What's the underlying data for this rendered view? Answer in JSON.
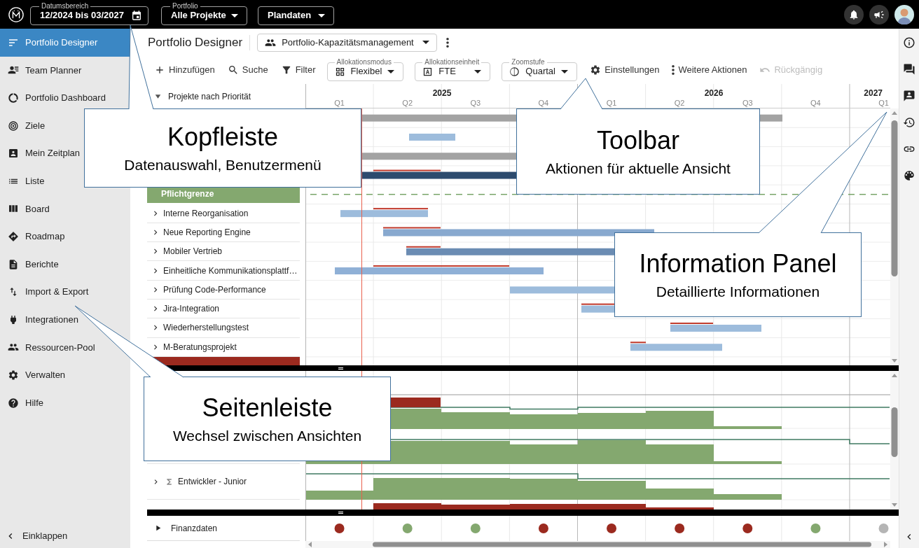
{
  "header": {
    "date_range": {
      "label": "Datumsbereich",
      "value": "12/2024 bis 03/2027"
    },
    "portfolio": {
      "label": "Portfolio",
      "value": "Alle Projekte"
    },
    "data_source": {
      "value": "Plandaten"
    }
  },
  "sidebar": {
    "items": [
      {
        "label": "Portfolio Designer",
        "selected": true
      },
      {
        "label": "Team Planner",
        "selected": false
      },
      {
        "label": "Portfolio Dashboard",
        "selected": false
      },
      {
        "label": "Ziele",
        "selected": false
      },
      {
        "label": "Mein Zeitplan",
        "selected": false
      },
      {
        "label": "Liste",
        "selected": false
      },
      {
        "label": "Board",
        "selected": false
      },
      {
        "label": "Roadmap",
        "selected": false
      },
      {
        "label": "Berichte",
        "selected": false
      },
      {
        "label": "Import & Export",
        "selected": false
      },
      {
        "label": "Integrationen",
        "selected": false
      },
      {
        "label": "Ressourcen-Pool",
        "selected": false
      },
      {
        "label": "Verwalten",
        "selected": false
      },
      {
        "label": "Hilfe",
        "selected": false
      }
    ],
    "collapse": "Einklappen"
  },
  "page": {
    "title": "Portfolio Designer",
    "view": "Portfolio-Kapazitätsmanagement"
  },
  "toolbar": [
    {
      "kind": "action",
      "label": "Hinzufügen",
      "disabled": false
    },
    {
      "kind": "action",
      "label": "Suche",
      "disabled": false
    },
    {
      "kind": "action",
      "label": "Filter",
      "disabled": false
    },
    {
      "kind": "select",
      "label": "Allokationsmodus",
      "value": "Flexibel"
    },
    {
      "kind": "select",
      "label": "Allokationseinheit",
      "value": "FTE"
    },
    {
      "kind": "select",
      "label": "Zoomstufe",
      "value": "Quartal"
    },
    {
      "kind": "action",
      "label": "Einstellungen",
      "disabled": false
    },
    {
      "kind": "action",
      "label": "Weitere Aktionen",
      "disabled": false
    },
    {
      "kind": "action",
      "label": "Rückgängig",
      "disabled": true
    }
  ],
  "timeline": {
    "years": [
      "2025",
      "2026",
      "2027"
    ],
    "quarters": [
      "Q1",
      "Q2",
      "Q3",
      "Q4",
      "Q1",
      "Q2",
      "Q3",
      "Q4",
      "Q1"
    ]
  },
  "projects": {
    "header": "Projekte nach Priorität",
    "expanded": true,
    "rows": [
      {
        "kind": "limit",
        "label": "Pflichtgrenze"
      },
      {
        "kind": "project",
        "label": "Interne Reorganisation",
        "expanded": false
      },
      {
        "kind": "project",
        "label": "Neue Reporting Engine",
        "expanded": false
      },
      {
        "kind": "project",
        "label": "Mobiler Vertrieb",
        "expanded": false
      },
      {
        "kind": "project",
        "label": "Einheitliche Kommunikationsplattf…",
        "expanded": false
      },
      {
        "kind": "project",
        "label": "Prüfung Code-Performance",
        "expanded": false
      },
      {
        "kind": "project",
        "label": "Jira-Integration",
        "expanded": false
      },
      {
        "kind": "project",
        "label": "Wiederherstellungstest",
        "expanded": false
      },
      {
        "kind": "project",
        "label": "M-Beratungsprojekt",
        "expanded": false
      }
    ]
  },
  "resources": {
    "rows": [
      {
        "label": "Entwickler - Junior",
        "expanded": false
      }
    ]
  },
  "finance": {
    "label": "Finanzdaten",
    "expanded": false,
    "dots": [
      {
        "color": "#9b2a1f"
      },
      {
        "color": "#84a86f"
      },
      {
        "color": "#84a86f"
      },
      {
        "color": "#9b2a1f"
      },
      {
        "color": "#9b2a1f"
      },
      {
        "color": "#9b2a1f"
      },
      {
        "color": "#9b2a1f"
      },
      {
        "color": "#84a86f"
      },
      {
        "color": "#b5b5b5"
      }
    ]
  },
  "callouts": [
    {
      "title": "Kopfleiste",
      "text": "Datenauswahl, Benutzermenü"
    },
    {
      "title": "Toolbar",
      "text": "Aktionen für aktuelle Ansicht"
    },
    {
      "title": "Information Panel",
      "text": "Detaillierte Informationen"
    },
    {
      "title": "Seitenleiste",
      "text": "Wechsel zwischen Ansichten"
    }
  ]
}
